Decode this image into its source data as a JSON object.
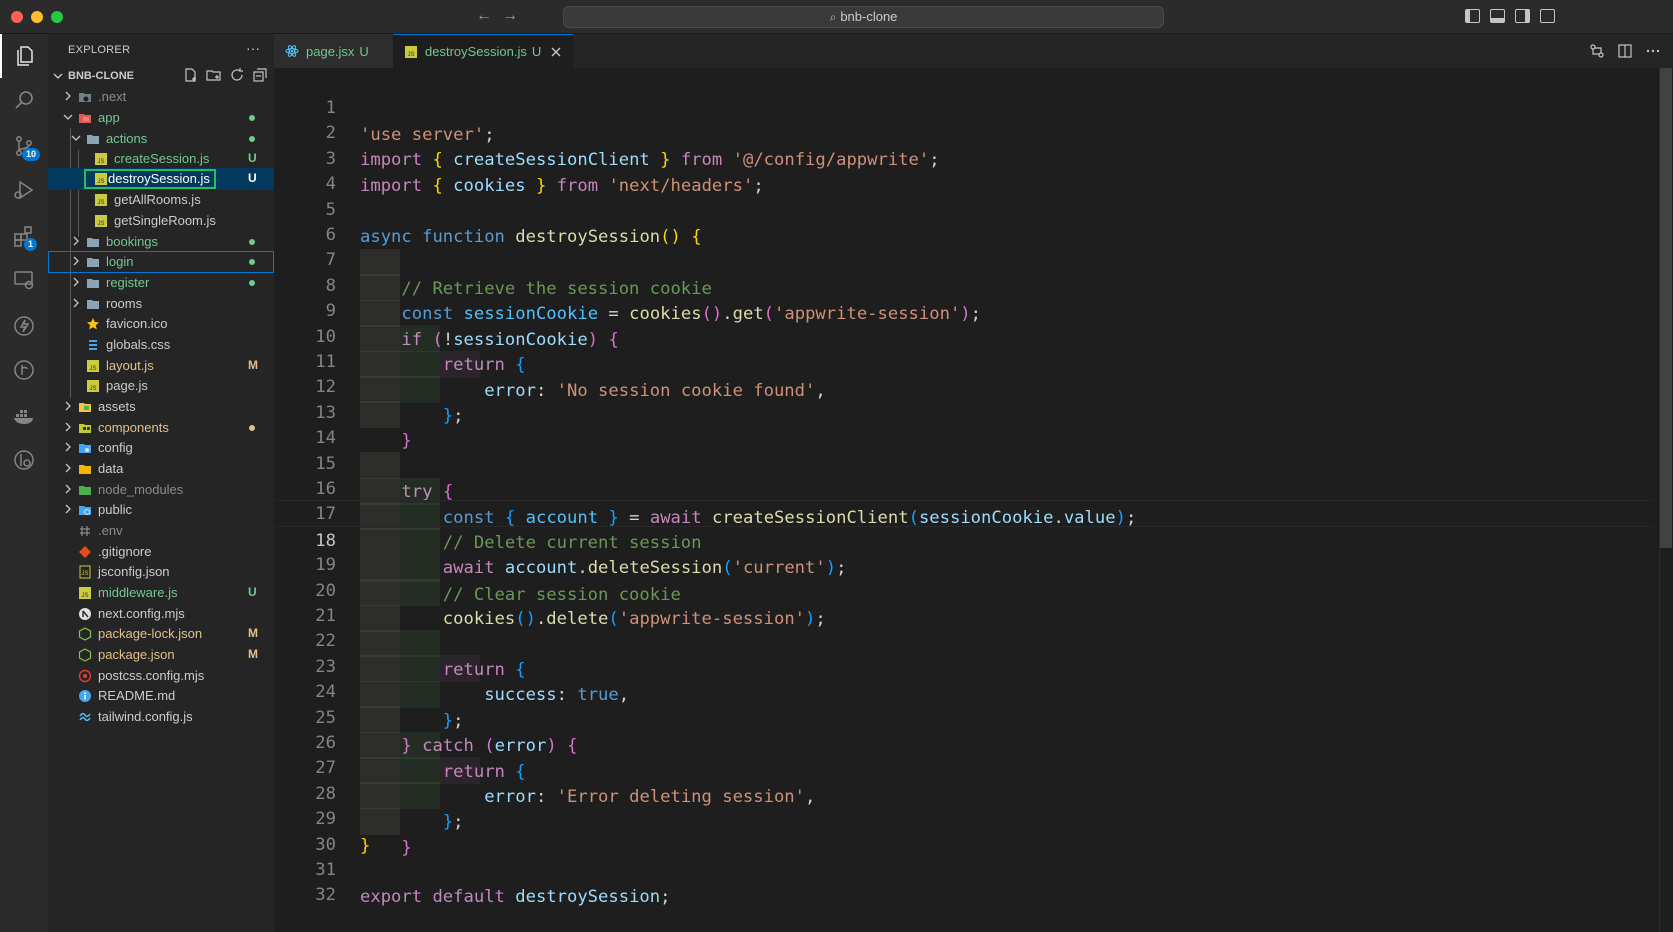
{
  "window": {
    "search_text": "bnb-clone"
  },
  "activity": {
    "source_control_badge": "10",
    "extensions_badge": "1"
  },
  "explorer": {
    "header": "EXPLORER",
    "more": "···",
    "project": "BNB-CLONE",
    "items": [
      {
        "label": ".next",
        "status": "",
        "color": "#8c8c8c"
      },
      {
        "label": "app",
        "status": "",
        "color": "#73c991"
      },
      {
        "label": "actions",
        "status": "",
        "color": "#73c991"
      },
      {
        "label": "createSession.js",
        "status": "U",
        "color": "#73c991"
      },
      {
        "label": "destroySession.js",
        "status": "U",
        "color": "#ffffff"
      },
      {
        "label": "getAllRooms.js",
        "status": "",
        "color": "#cccccc"
      },
      {
        "label": "getSingleRoom.js",
        "status": "",
        "color": "#cccccc"
      },
      {
        "label": "bookings",
        "status": "",
        "color": "#73c991"
      },
      {
        "label": "login",
        "status": "",
        "color": "#73c991"
      },
      {
        "label": "register",
        "status": "",
        "color": "#73c991"
      },
      {
        "label": "rooms",
        "status": "",
        "color": "#cccccc"
      },
      {
        "label": "favicon.ico",
        "status": "",
        "color": "#cccccc"
      },
      {
        "label": "globals.css",
        "status": "",
        "color": "#cccccc"
      },
      {
        "label": "layout.js",
        "status": "M",
        "color": "#e2c08d"
      },
      {
        "label": "page.js",
        "status": "",
        "color": "#cccccc"
      },
      {
        "label": "assets",
        "status": "",
        "color": "#cccccc"
      },
      {
        "label": "components",
        "status": "",
        "color": "#e2c08d"
      },
      {
        "label": "config",
        "status": "",
        "color": "#cccccc"
      },
      {
        "label": "data",
        "status": "",
        "color": "#cccccc"
      },
      {
        "label": "node_modules",
        "status": "",
        "color": "#8c8c8c"
      },
      {
        "label": "public",
        "status": "",
        "color": "#cccccc"
      },
      {
        "label": ".env",
        "status": "",
        "color": "#8c8c8c"
      },
      {
        "label": ".gitignore",
        "status": "",
        "color": "#cccccc"
      },
      {
        "label": "jsconfig.json",
        "status": "",
        "color": "#cccccc"
      },
      {
        "label": "middleware.js",
        "status": "U",
        "color": "#73c991"
      },
      {
        "label": "next.config.mjs",
        "status": "",
        "color": "#cccccc"
      },
      {
        "label": "package-lock.json",
        "status": "M",
        "color": "#e2c08d"
      },
      {
        "label": "package.json",
        "status": "M",
        "color": "#e2c08d"
      },
      {
        "label": "postcss.config.mjs",
        "status": "",
        "color": "#cccccc"
      },
      {
        "label": "README.md",
        "status": "",
        "color": "#cccccc"
      },
      {
        "label": "tailwind.config.js",
        "status": "",
        "color": "#cccccc"
      }
    ]
  },
  "tabs": [
    {
      "label": "page.jsx",
      "status": "U",
      "active": false
    },
    {
      "label": "destroySession.js",
      "status": "U",
      "active": true
    }
  ],
  "editor": {
    "current_line": "18",
    "line_numbers": [
      "1",
      "2",
      "3",
      "4",
      "5",
      "6",
      "7",
      "8",
      "9",
      "10",
      "11",
      "12",
      "13",
      "14",
      "15",
      "16",
      "17",
      "18",
      "19",
      "20",
      "21",
      "22",
      "23",
      "24",
      "25",
      "26",
      "27",
      "28",
      "29",
      "30",
      "31",
      "32"
    ],
    "code_lines": [
      "'use server';",
      "import { createSessionClient } from '@/config/appwrite';",
      "import { cookies } from 'next/headers';",
      "",
      "async function destroySession() {",
      "  // Retrieve the session cookie",
      "  const sessionCookie = cookies().get('appwrite-session');",
      "  if (!sessionCookie) {",
      "    return {",
      "      error: 'No session cookie found',",
      "    };",
      "  }",
      "",
      "  try {",
      "    const { account } = await createSessionClient(sessionCookie.value);",
      "    // Delete current session",
      "    await account.deleteSession('current');",
      "    // Clear session cookie",
      "    cookies().delete('appwrite-session');",
      "",
      "    return {",
      "      success: true,",
      "    };",
      "  } catch (error) {",
      "    return {",
      "      error: 'Error deleting session',",
      "    };",
      "  }",
      "}",
      "",
      "export default destroySession;",
      ""
    ]
  }
}
